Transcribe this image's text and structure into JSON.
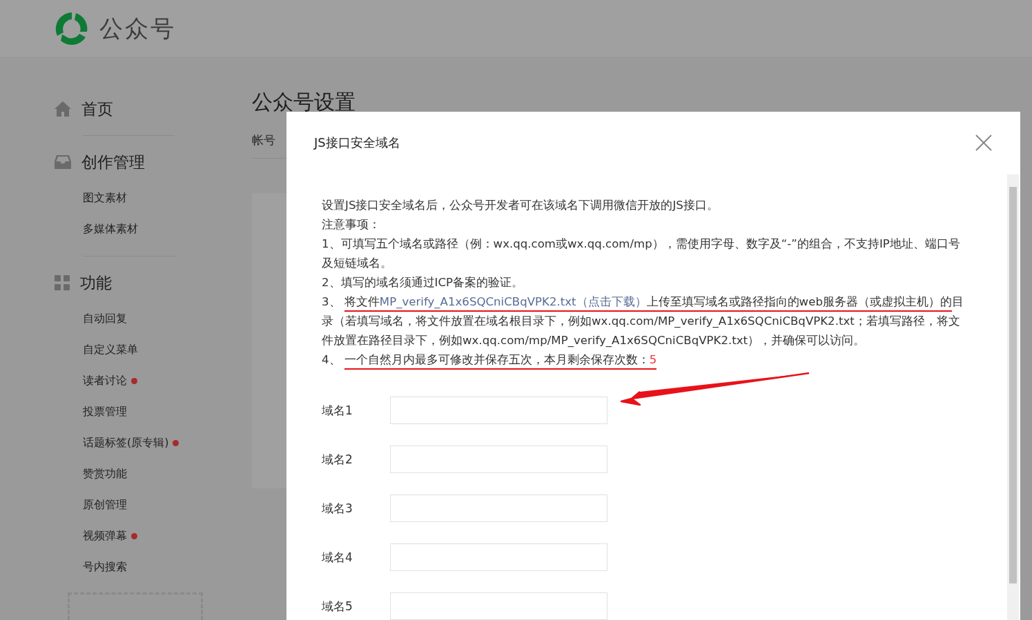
{
  "header": {
    "logo_text": "公众号"
  },
  "sidebar": {
    "sections": [
      {
        "title": "首页"
      },
      {
        "title": "创作管理",
        "items": [
          {
            "label": "图文素材",
            "dot": false
          },
          {
            "label": "多媒体素材",
            "dot": false
          }
        ]
      },
      {
        "title": "功能",
        "items": [
          {
            "label": "自动回复",
            "dot": false
          },
          {
            "label": "自定义菜单",
            "dot": false
          },
          {
            "label": "读者讨论",
            "dot": true
          },
          {
            "label": "投票管理",
            "dot": false
          },
          {
            "label": "话题标签(原专辑)",
            "dot": true
          },
          {
            "label": "赞赏功能",
            "dot": false
          },
          {
            "label": "原创管理",
            "dot": false
          },
          {
            "label": "视频弹幕",
            "dot": true
          },
          {
            "label": "号内搜索",
            "dot": false
          }
        ]
      }
    ]
  },
  "main": {
    "title": "公众号设置",
    "tab": "帐号"
  },
  "modal": {
    "title": "JS接口安全域名",
    "intro": "设置JS接口安全域名后，公众号开发者可在该域名下调用微信开放的JS接口。",
    "notes_heading": "注意事项：",
    "notes": [
      {
        "kind": "plain",
        "text": "1、可填写五个域名或路径（例：wx.qq.com或wx.qq.com/mp），需使用字母、数字及“-”的组合，不支持IP地址、端口号及短链域名。"
      },
      {
        "kind": "plain",
        "text": "2、填写的域名须通过ICP备案的验证。"
      },
      {
        "kind": "link",
        "number": "3、 ",
        "before": "将文件",
        "link": "MP_verify_A1x6SQCniCBqVPK2.txt（点击下载）",
        "after": "上传至填写域名或路径指向的web服务器（或虚拟主机）的",
        "rest": "目录（若填写域名，将文件放置在域名根目录下，例如wx.qq.com/MP_verify_A1x6SQCniCBqVPK2.txt；若填写路径，将文件放置在路径目录下，例如wx.qq.com/mp/MP_verify_A1x6SQCniCBqVPK2.txt），并确保可以访问。",
        "underlined": true
      },
      {
        "kind": "count",
        "number": "4、 ",
        "text": "一个自然月内最多可修改并保存五次，本月剩余保存次数：",
        "count": "5",
        "underlined": true
      }
    ],
    "fields": [
      {
        "label": "域名1"
      },
      {
        "label": "域名2"
      },
      {
        "label": "域名3"
      },
      {
        "label": "域名4"
      },
      {
        "label": "域名5"
      }
    ]
  }
}
